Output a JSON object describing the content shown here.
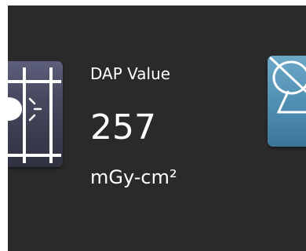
{
  "dap": {
    "label": "DAP Value",
    "value": "257",
    "unit": "mGy-cm²"
  },
  "icons": {
    "collimator": "collimator-light-icon",
    "right_tile": "tube-disabled-icon"
  }
}
